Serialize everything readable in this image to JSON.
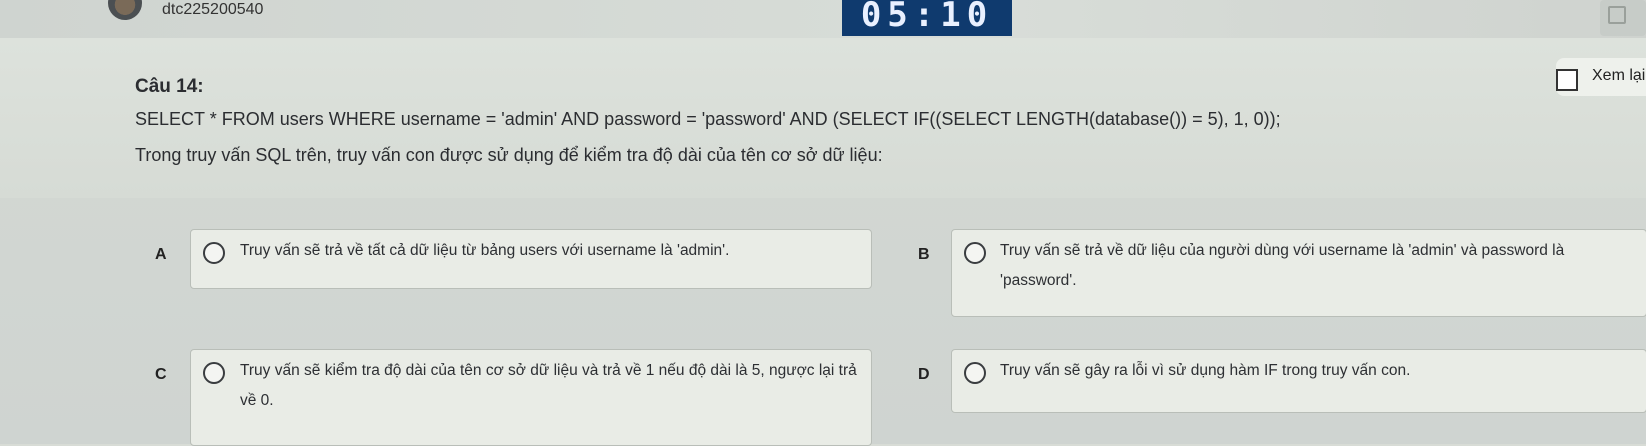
{
  "header": {
    "username": "dtc225200540",
    "timer": "05:10"
  },
  "question": {
    "number_label": "Câu 14:",
    "sql": "SELECT * FROM users WHERE username = 'admin' AND password = 'password' AND (SELECT IF((SELECT LENGTH(database()) = 5), 1, 0));",
    "prompt": "Trong truy vấn SQL trên, truy vấn con được sử dụng để kiểm tra độ dài của tên cơ sở dữ liệu:",
    "review_label": "Xem lại"
  },
  "options": [
    {
      "letter": "A",
      "text": "Truy vấn sẽ trả về tất cả dữ liệu từ bảng users với username là 'admin'."
    },
    {
      "letter": "B",
      "text": "Truy vấn sẽ trả về dữ liệu của người dùng với username là 'admin' và password là 'password'."
    },
    {
      "letter": "C",
      "text": "Truy vấn sẽ kiểm tra độ dài của tên cơ sở dữ liệu và trả về 1 nếu độ dài là 5, ngược lại trả về 0."
    },
    {
      "letter": "D",
      "text": "Truy vấn sẽ gây ra lỗi vì sử dụng hàm IF trong truy vấn con."
    }
  ]
}
